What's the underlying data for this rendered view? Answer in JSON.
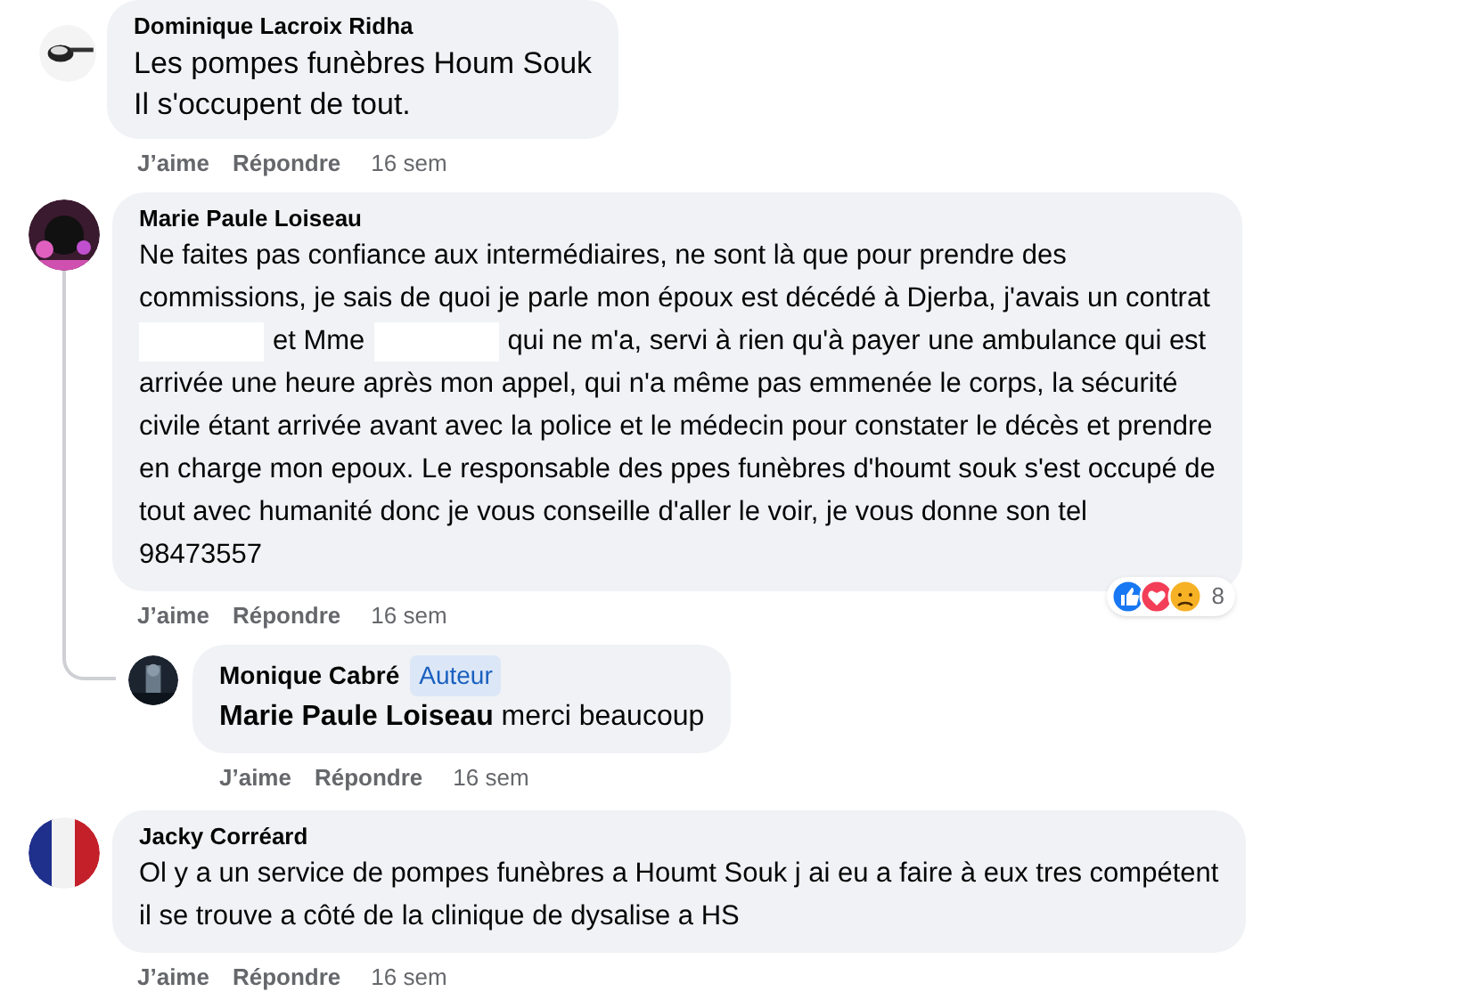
{
  "comments": [
    {
      "author": "Dominique Lacroix Ridha",
      "large_text": true,
      "lines": [
        [
          {
            "kind": "text",
            "text": "Les pompes funèbres Houm Souk"
          }
        ],
        [
          {
            "kind": "text",
            "text": "Il s'occupent de tout."
          }
        ]
      ],
      "actions": [
        "J’aime",
        "Répondre"
      ],
      "time": "16 sem"
    },
    {
      "author": "Marie Paule Loiseau",
      "large_text": false,
      "lines": [
        [
          {
            "kind": "text",
            "text": "Ne faites pas confiance aux intermédiaires, ne sont là que pour prendre des"
          }
        ],
        [
          {
            "kind": "text",
            "text": "commissions, je sais de quoi je parle mon époux est décédé à Djerba, j'avais un contrat"
          }
        ],
        [
          {
            "kind": "redacted"
          },
          {
            "kind": "text",
            "text": "et Mme"
          },
          {
            "kind": "redacted"
          },
          {
            "kind": "text",
            "text": "qui ne m'a, servi à rien qu'à payer une ambulance qui est"
          }
        ],
        [
          {
            "kind": "text",
            "text": "arrivée une heure après mon appel, qui n'a même pas emmenée le corps, la sécurité"
          }
        ],
        [
          {
            "kind": "text",
            "text": "civile étant arrivée avant avec la police et le médecin pour constater le décès et prendre"
          }
        ],
        [
          {
            "kind": "text",
            "text": "en charge mon epoux. Le responsable des ppes funèbres d'houmt souk s'est occupé de"
          }
        ],
        [
          {
            "kind": "text",
            "text": "tout avec humanité donc je vous conseille d'aller le voir, je vous donne son tel"
          }
        ],
        [
          {
            "kind": "text",
            "text": "98473557"
          }
        ]
      ],
      "actions": [
        "J’aime",
        "Répondre"
      ],
      "time": "16 sem",
      "reactions": {
        "count": "8"
      },
      "replies": [
        {
          "author": "Monique Cabré",
          "badge": "Auteur",
          "text": "**Marie Paule Loiseau** merci beaucoup",
          "actions": [
            "J’aime",
            "Répondre"
          ],
          "time": "16 sem"
        }
      ]
    },
    {
      "author": "Jacky Corréard",
      "large_text": false,
      "lines": [
        [
          {
            "kind": "text",
            "text": "Ol y a un service de pompes funèbres a Houmt Souk j ai eu a faire à eux tres compétent"
          }
        ],
        [
          {
            "kind": "text",
            "text": "il se trouve a côté de la clinique de dysalise a HS"
          }
        ]
      ],
      "actions": [
        "J’aime",
        "Répondre"
      ],
      "time": "16 sem"
    }
  ]
}
